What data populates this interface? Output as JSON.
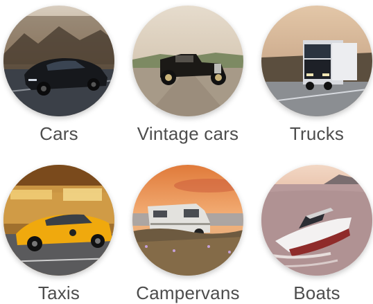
{
  "categories": [
    {
      "label": "Cars",
      "icon": "car-photo"
    },
    {
      "label": "Vintage cars",
      "icon": "vintage-car-photo"
    },
    {
      "label": "Trucks",
      "icon": "truck-photo"
    },
    {
      "label": "Taxis",
      "icon": "taxi-photo"
    },
    {
      "label": "Campervans",
      "icon": "campervan-photo"
    },
    {
      "label": "Boats",
      "icon": "boat-photo"
    }
  ]
}
